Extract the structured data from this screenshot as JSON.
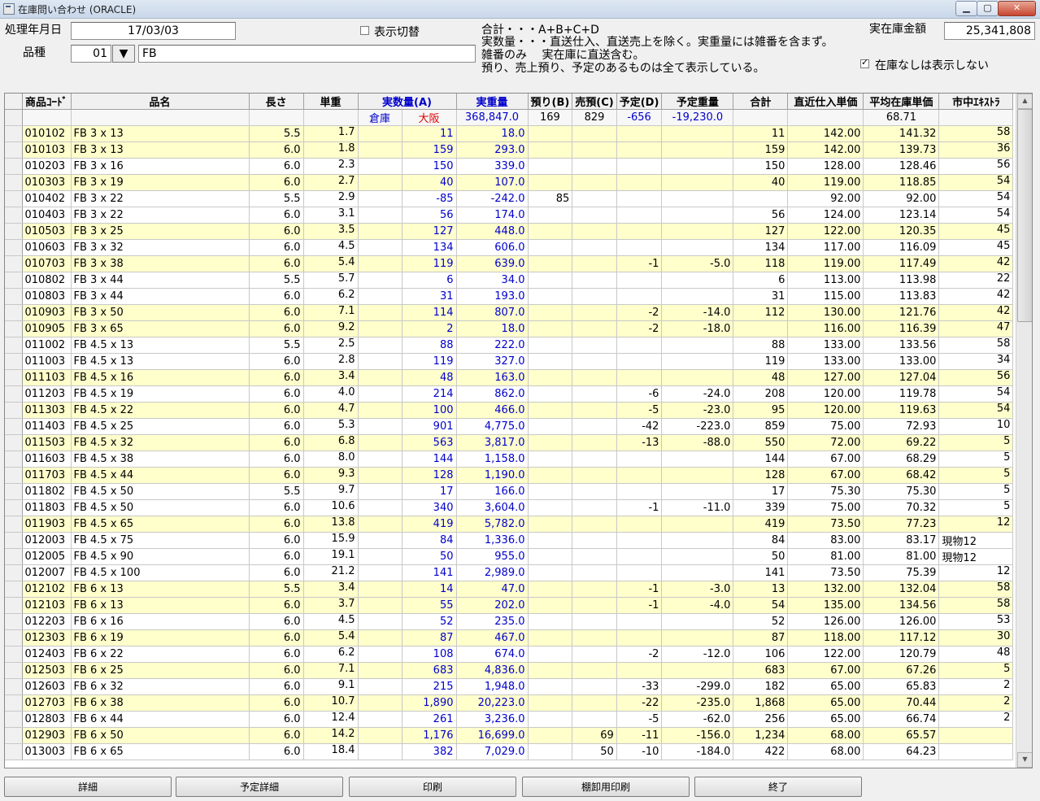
{
  "window": {
    "title": "在庫問い合わせ (ORACLE)"
  },
  "form": {
    "date_label": "処理年月日",
    "date_value": "17/03/03",
    "kind_label": "品種",
    "kind_code": "01",
    "kind_name": "FB",
    "toggle_label": "表示切替",
    "notes": [
      "合計・・・A+B+C+D",
      "実数量・・・直送仕入、直送売上を除く。実重量には雑番を含まず。",
      "雑番のみ　 実在庫に直送含む。",
      "預り、売上預り、予定のあるものは全て表示している。"
    ],
    "amount_label": "実在庫金額",
    "amount_value": "25,341,808",
    "hide_zero_label": "在庫なしは表示しない",
    "hide_zero_checked": true
  },
  "grid": {
    "headers": [
      "商品ｺｰﾄﾞ",
      "品名",
      "長さ",
      "単重",
      "実数量(A)",
      "実重量",
      "預り(B)",
      "売預(C)",
      "予定(D)",
      "予定重量",
      "合計",
      "直近仕入単価",
      "平均在庫単価",
      "市中ｴｷｽﾄﾗ"
    ],
    "subheader": {
      "warehouse": "倉庫",
      "osaka": "大阪",
      "weight_total": "368,847.0",
      "b": "169",
      "c": "829",
      "d": "-656",
      "d_weight": "-19,230.0",
      "avg_price": "68.71"
    },
    "rows": [
      {
        "code": "010102",
        "name": "FB 3 x 13",
        "len": "5.5",
        "uw": "1.7",
        "qty": "11",
        "wt": "18.0",
        "b": "",
        "c": "",
        "d": "",
        "dw": "",
        "sum": "11",
        "last": "142.00",
        "avg": "141.32",
        "ext": "58",
        "hl": true
      },
      {
        "code": "010103",
        "name": "FB 3 x 13",
        "len": "6.0",
        "uw": "1.8",
        "qty": "159",
        "wt": "293.0",
        "b": "",
        "c": "",
        "d": "",
        "dw": "",
        "sum": "159",
        "last": "142.00",
        "avg": "139.73",
        "ext": "36",
        "hl": true
      },
      {
        "code": "010203",
        "name": "FB 3 x 16",
        "len": "6.0",
        "uw": "2.3",
        "qty": "150",
        "wt": "339.0",
        "b": "",
        "c": "",
        "d": "",
        "dw": "",
        "sum": "150",
        "last": "128.00",
        "avg": "128.46",
        "ext": "56",
        "hl": false
      },
      {
        "code": "010303",
        "name": "FB 3 x 19",
        "len": "6.0",
        "uw": "2.7",
        "qty": "40",
        "wt": "107.0",
        "b": "",
        "c": "",
        "d": "",
        "dw": "",
        "sum": "40",
        "last": "119.00",
        "avg": "118.85",
        "ext": "54",
        "hl": true
      },
      {
        "code": "010402",
        "name": "FB 3 x 22",
        "len": "5.5",
        "uw": "2.9",
        "qty": "-85",
        "wt": "-242.0",
        "b": "85",
        "c": "",
        "d": "",
        "dw": "",
        "sum": "",
        "last": "92.00",
        "avg": "92.00",
        "ext": "54",
        "hl": false
      },
      {
        "code": "010403",
        "name": "FB 3 x 22",
        "len": "6.0",
        "uw": "3.1",
        "qty": "56",
        "wt": "174.0",
        "b": "",
        "c": "",
        "d": "",
        "dw": "",
        "sum": "56",
        "last": "124.00",
        "avg": "123.14",
        "ext": "54",
        "hl": false
      },
      {
        "code": "010503",
        "name": "FB 3 x 25",
        "len": "6.0",
        "uw": "3.5",
        "qty": "127",
        "wt": "448.0",
        "b": "",
        "c": "",
        "d": "",
        "dw": "",
        "sum": "127",
        "last": "122.00",
        "avg": "120.35",
        "ext": "45",
        "hl": true
      },
      {
        "code": "010603",
        "name": "FB 3 x 32",
        "len": "6.0",
        "uw": "4.5",
        "qty": "134",
        "wt": "606.0",
        "b": "",
        "c": "",
        "d": "",
        "dw": "",
        "sum": "134",
        "last": "117.00",
        "avg": "116.09",
        "ext": "45",
        "hl": false
      },
      {
        "code": "010703",
        "name": "FB 3 x 38",
        "len": "6.0",
        "uw": "5.4",
        "qty": "119",
        "wt": "639.0",
        "b": "",
        "c": "",
        "d": "-1",
        "dw": "-5.0",
        "sum": "118",
        "last": "119.00",
        "avg": "117.49",
        "ext": "42",
        "hl": true
      },
      {
        "code": "010802",
        "name": "FB 3 x 44",
        "len": "5.5",
        "uw": "5.7",
        "qty": "6",
        "wt": "34.0",
        "b": "",
        "c": "",
        "d": "",
        "dw": "",
        "sum": "6",
        "last": "113.00",
        "avg": "113.98",
        "ext": "22",
        "hl": false
      },
      {
        "code": "010803",
        "name": "FB 3 x 44",
        "len": "6.0",
        "uw": "6.2",
        "qty": "31",
        "wt": "193.0",
        "b": "",
        "c": "",
        "d": "",
        "dw": "",
        "sum": "31",
        "last": "115.00",
        "avg": "113.83",
        "ext": "42",
        "hl": false
      },
      {
        "code": "010903",
        "name": "FB 3 x 50",
        "len": "6.0",
        "uw": "7.1",
        "qty": "114",
        "wt": "807.0",
        "b": "",
        "c": "",
        "d": "-2",
        "dw": "-14.0",
        "sum": "112",
        "last": "130.00",
        "avg": "121.76",
        "ext": "42",
        "hl": true
      },
      {
        "code": "010905",
        "name": "FB 3 x 65",
        "len": "6.0",
        "uw": "9.2",
        "qty": "2",
        "wt": "18.0",
        "b": "",
        "c": "",
        "d": "-2",
        "dw": "-18.0",
        "sum": "",
        "last": "116.00",
        "avg": "116.39",
        "ext": "47",
        "hl": true
      },
      {
        "code": "011002",
        "name": "FB 4.5 x 13",
        "len": "5.5",
        "uw": "2.5",
        "qty": "88",
        "wt": "222.0",
        "b": "",
        "c": "",
        "d": "",
        "dw": "",
        "sum": "88",
        "last": "133.00",
        "avg": "133.56",
        "ext": "58",
        "hl": false
      },
      {
        "code": "011003",
        "name": "FB 4.5 x 13",
        "len": "6.0",
        "uw": "2.8",
        "qty": "119",
        "wt": "327.0",
        "b": "",
        "c": "",
        "d": "",
        "dw": "",
        "sum": "119",
        "last": "133.00",
        "avg": "133.00",
        "ext": "34",
        "hl": false
      },
      {
        "code": "011103",
        "name": "FB 4.5 x 16",
        "len": "6.0",
        "uw": "3.4",
        "qty": "48",
        "wt": "163.0",
        "b": "",
        "c": "",
        "d": "",
        "dw": "",
        "sum": "48",
        "last": "127.00",
        "avg": "127.04",
        "ext": "56",
        "hl": true
      },
      {
        "code": "011203",
        "name": "FB 4.5 x 19",
        "len": "6.0",
        "uw": "4.0",
        "qty": "214",
        "wt": "862.0",
        "b": "",
        "c": "",
        "d": "-6",
        "dw": "-24.0",
        "sum": "208",
        "last": "120.00",
        "avg": "119.78",
        "ext": "54",
        "hl": false
      },
      {
        "code": "011303",
        "name": "FB 4.5 x 22",
        "len": "6.0",
        "uw": "4.7",
        "qty": "100",
        "wt": "466.0",
        "b": "",
        "c": "",
        "d": "-5",
        "dw": "-23.0",
        "sum": "95",
        "last": "120.00",
        "avg": "119.63",
        "ext": "54",
        "hl": true
      },
      {
        "code": "011403",
        "name": "FB 4.5 x 25",
        "len": "6.0",
        "uw": "5.3",
        "qty": "901",
        "wt": "4,775.0",
        "b": "",
        "c": "",
        "d": "-42",
        "dw": "-223.0",
        "sum": "859",
        "last": "75.00",
        "avg": "72.93",
        "ext": "10",
        "hl": false
      },
      {
        "code": "011503",
        "name": "FB 4.5 x 32",
        "len": "6.0",
        "uw": "6.8",
        "qty": "563",
        "wt": "3,817.0",
        "b": "",
        "c": "",
        "d": "-13",
        "dw": "-88.0",
        "sum": "550",
        "last": "72.00",
        "avg": "69.22",
        "ext": "5",
        "hl": true
      },
      {
        "code": "011603",
        "name": "FB 4.5 x 38",
        "len": "6.0",
        "uw": "8.0",
        "qty": "144",
        "wt": "1,158.0",
        "b": "",
        "c": "",
        "d": "",
        "dw": "",
        "sum": "144",
        "last": "67.00",
        "avg": "68.29",
        "ext": "5",
        "hl": false
      },
      {
        "code": "011703",
        "name": "FB 4.5 x 44",
        "len": "6.0",
        "uw": "9.3",
        "qty": "128",
        "wt": "1,190.0",
        "b": "",
        "c": "",
        "d": "",
        "dw": "",
        "sum": "128",
        "last": "67.00",
        "avg": "68.42",
        "ext": "5",
        "hl": true
      },
      {
        "code": "011802",
        "name": "FB 4.5 x 50",
        "len": "5.5",
        "uw": "9.7",
        "qty": "17",
        "wt": "166.0",
        "b": "",
        "c": "",
        "d": "",
        "dw": "",
        "sum": "17",
        "last": "75.30",
        "avg": "75.30",
        "ext": "5",
        "hl": false
      },
      {
        "code": "011803",
        "name": "FB 4.5 x 50",
        "len": "6.0",
        "uw": "10.6",
        "qty": "340",
        "wt": "3,604.0",
        "b": "",
        "c": "",
        "d": "-1",
        "dw": "-11.0",
        "sum": "339",
        "last": "75.00",
        "avg": "70.32",
        "ext": "5",
        "hl": false
      },
      {
        "code": "011903",
        "name": "FB 4.5 x 65",
        "len": "6.0",
        "uw": "13.8",
        "qty": "419",
        "wt": "5,782.0",
        "b": "",
        "c": "",
        "d": "",
        "dw": "",
        "sum": "419",
        "last": "73.50",
        "avg": "77.23",
        "ext": "12",
        "hl": true
      },
      {
        "code": "012003",
        "name": "FB 4.5 x 75",
        "len": "6.0",
        "uw": "15.9",
        "qty": "84",
        "wt": "1,336.0",
        "b": "",
        "c": "",
        "d": "",
        "dw": "",
        "sum": "84",
        "last": "83.00",
        "avg": "83.17",
        "ext": "現物12",
        "hl": false
      },
      {
        "code": "012005",
        "name": "FB 4.5 x 90",
        "len": "6.0",
        "uw": "19.1",
        "qty": "50",
        "wt": "955.0",
        "b": "",
        "c": "",
        "d": "",
        "dw": "",
        "sum": "50",
        "last": "81.00",
        "avg": "81.00",
        "ext": "現物12",
        "hl": false
      },
      {
        "code": "012007",
        "name": "FB 4.5 x 100",
        "len": "6.0",
        "uw": "21.2",
        "qty": "141",
        "wt": "2,989.0",
        "b": "",
        "c": "",
        "d": "",
        "dw": "",
        "sum": "141",
        "last": "73.50",
        "avg": "75.39",
        "ext": "12",
        "hl": false
      },
      {
        "code": "012102",
        "name": "FB 6 x 13",
        "len": "5.5",
        "uw": "3.4",
        "qty": "14",
        "wt": "47.0",
        "b": "",
        "c": "",
        "d": "-1",
        "dw": "-3.0",
        "sum": "13",
        "last": "132.00",
        "avg": "132.04",
        "ext": "58",
        "hl": true
      },
      {
        "code": "012103",
        "name": "FB 6 x 13",
        "len": "6.0",
        "uw": "3.7",
        "qty": "55",
        "wt": "202.0",
        "b": "",
        "c": "",
        "d": "-1",
        "dw": "-4.0",
        "sum": "54",
        "last": "135.00",
        "avg": "134.56",
        "ext": "58",
        "hl": true
      },
      {
        "code": "012203",
        "name": "FB 6 x 16",
        "len": "6.0",
        "uw": "4.5",
        "qty": "52",
        "wt": "235.0",
        "b": "",
        "c": "",
        "d": "",
        "dw": "",
        "sum": "52",
        "last": "126.00",
        "avg": "126.00",
        "ext": "53",
        "hl": false
      },
      {
        "code": "012303",
        "name": "FB 6 x 19",
        "len": "6.0",
        "uw": "5.4",
        "qty": "87",
        "wt": "467.0",
        "b": "",
        "c": "",
        "d": "",
        "dw": "",
        "sum": "87",
        "last": "118.00",
        "avg": "117.12",
        "ext": "30",
        "hl": true
      },
      {
        "code": "012403",
        "name": "FB 6 x 22",
        "len": "6.0",
        "uw": "6.2",
        "qty": "108",
        "wt": "674.0",
        "b": "",
        "c": "",
        "d": "-2",
        "dw": "-12.0",
        "sum": "106",
        "last": "122.00",
        "avg": "120.79",
        "ext": "48",
        "hl": false
      },
      {
        "code": "012503",
        "name": "FB 6 x 25",
        "len": "6.0",
        "uw": "7.1",
        "qty": "683",
        "wt": "4,836.0",
        "b": "",
        "c": "",
        "d": "",
        "dw": "",
        "sum": "683",
        "last": "67.00",
        "avg": "67.26",
        "ext": "5",
        "hl": true
      },
      {
        "code": "012603",
        "name": "FB 6 x 32",
        "len": "6.0",
        "uw": "9.1",
        "qty": "215",
        "wt": "1,948.0",
        "b": "",
        "c": "",
        "d": "-33",
        "dw": "-299.0",
        "sum": "182",
        "last": "65.00",
        "avg": "65.83",
        "ext": "2",
        "hl": false
      },
      {
        "code": "012703",
        "name": "FB 6 x 38",
        "len": "6.0",
        "uw": "10.7",
        "qty": "1,890",
        "wt": "20,223.0",
        "b": "",
        "c": "",
        "d": "-22",
        "dw": "-235.0",
        "sum": "1,868",
        "last": "65.00",
        "avg": "70.44",
        "ext": "2",
        "hl": true
      },
      {
        "code": "012803",
        "name": "FB 6 x 44",
        "len": "6.0",
        "uw": "12.4",
        "qty": "261",
        "wt": "3,236.0",
        "b": "",
        "c": "",
        "d": "-5",
        "dw": "-62.0",
        "sum": "256",
        "last": "65.00",
        "avg": "66.74",
        "ext": "2",
        "hl": false
      },
      {
        "code": "012903",
        "name": "FB 6 x 50",
        "len": "6.0",
        "uw": "14.2",
        "qty": "1,176",
        "wt": "16,699.0",
        "b": "",
        "c": "69",
        "d": "-11",
        "dw": "-156.0",
        "sum": "1,234",
        "last": "68.00",
        "avg": "65.57",
        "ext": "",
        "hl": true
      },
      {
        "code": "013003",
        "name": "FB 6 x 65",
        "len": "6.0",
        "uw": "18.4",
        "qty": "382",
        "wt": "7,029.0",
        "b": "",
        "c": "50",
        "d": "-10",
        "dw": "-184.0",
        "sum": "422",
        "last": "68.00",
        "avg": "64.23",
        "ext": "",
        "hl": false
      }
    ]
  },
  "buttons": {
    "detail": "詳細",
    "plan_detail": "予定詳細",
    "print": "印刷",
    "inventory_print": "棚卸用印刷",
    "exit": "終了"
  }
}
